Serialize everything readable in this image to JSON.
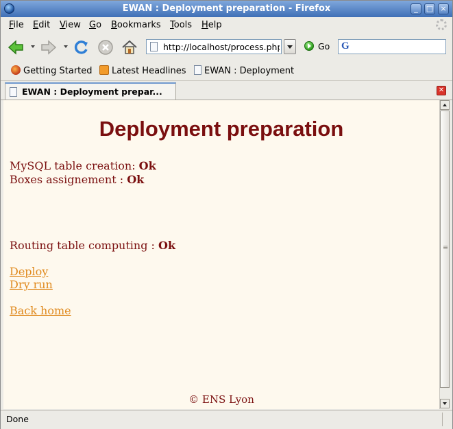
{
  "window": {
    "title": "EWAN : Deployment preparation - Firefox",
    "controls": [
      "minimize-icon",
      "maximize-icon",
      "close-icon"
    ]
  },
  "menu": {
    "items": [
      {
        "label": "File",
        "accel": "F"
      },
      {
        "label": "Edit",
        "accel": "E"
      },
      {
        "label": "View",
        "accel": "V"
      },
      {
        "label": "Go",
        "accel": "G"
      },
      {
        "label": "Bookmarks",
        "accel": "B"
      },
      {
        "label": "Tools",
        "accel": "T"
      },
      {
        "label": "Help",
        "accel": "H"
      }
    ]
  },
  "navigation": {
    "url": "http://localhost/process.php",
    "go_label": "Go",
    "search_value": ""
  },
  "bookmarks": [
    {
      "label": "Getting Started",
      "icon": "firefox-icon"
    },
    {
      "label": "Latest Headlines",
      "icon": "rss-icon"
    },
    {
      "label": "EWAN : Deployment",
      "icon": "page-icon"
    }
  ],
  "tabs": [
    {
      "label": "EWAN : Deployment prepar...",
      "active": true
    }
  ],
  "page": {
    "heading": "Deployment preparation",
    "mysql_label": "MySQL table creation: ",
    "mysql_status": "Ok",
    "boxes_label": "Boxes assignement : ",
    "boxes_status": "Ok",
    "routing_label": "Routing table computing : ",
    "routing_status": "Ok",
    "links": {
      "deploy": "Deploy",
      "dry_run": "Dry run",
      "back_home": "Back home"
    },
    "footer": "© ENS Lyon"
  },
  "status": {
    "text": "Done"
  },
  "colors": {
    "heading": "#7a0f0f",
    "link": "#e08a1e",
    "page_background": "#fef9ee"
  }
}
